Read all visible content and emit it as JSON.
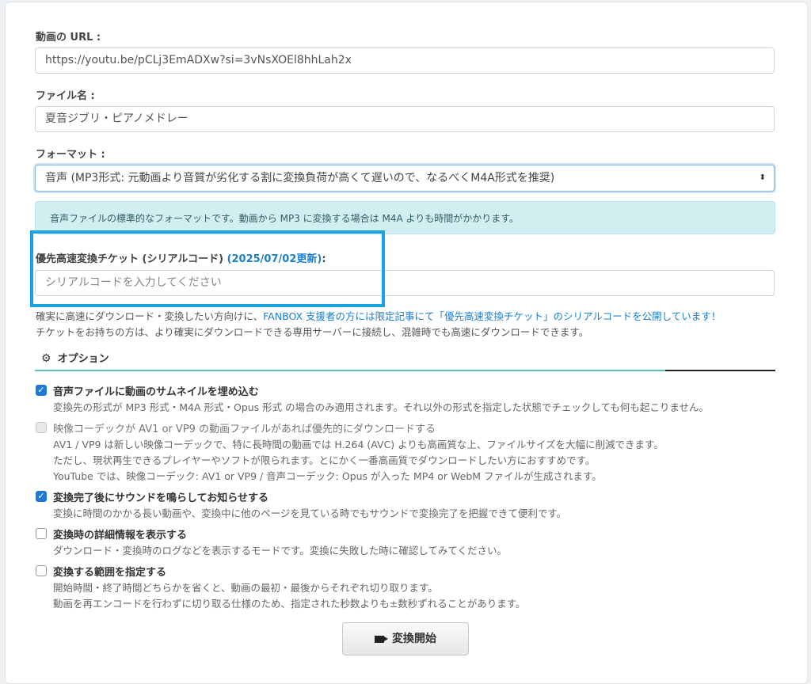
{
  "form": {
    "url_label": "動画の URL :",
    "url_value": "https://youtu.be/pCLj3EmADXw?si=3vNsXOEl8hhLah2x",
    "filename_label": "ファイル名 :",
    "filename_value": "夏音ジブリ・ピアノメドレー",
    "format_label": "フォーマット :",
    "format_selected": "音声 (MP3形式: 元動画より音質が劣化する割に変換負荷が高くて遅いので、なるべくM4A形式を推奨)",
    "format_info": "音声ファイルの標準的なフォーマットです。動画から MP3 に変換する場合は M4A よりも時間がかかります。",
    "ticket_label": "優先高速変換チケット (シリアルコード)",
    "ticket_update": "(2025/07/02更新)",
    "ticket_colon": ":",
    "ticket_placeholder": "シリアルコードを入力してください",
    "help_line1_a": "確実に高速にダウンロード・変換したい方向けに、",
    "help_line1_link": "FANBOX 支援者の方には限定記事にて「優先高速変換チケット」のシリアルコードを公開しています！",
    "help_line2": "チケットをお持ちの方は、より確実にダウンロードできる専用サーバーに接続し、混雑時でも高速にダウンロードできます。"
  },
  "options": {
    "title": "オプション",
    "items": [
      {
        "label": "音声ファイルに動画のサムネイルを埋め込む",
        "checked": true,
        "desc": [
          "変換先の形式が MP3 形式・M4A 形式・Opus 形式 の場合のみ適用されます。それ以外の形式を指定した状態でチェックしても何も起こりません。"
        ]
      },
      {
        "label": "映像コーデックが AV1 or VP9 の動画ファイルがあれば優先的にダウンロードする",
        "checked": false,
        "disabled": true,
        "desc": [
          "AV1 / VP9 は新しい映像コーデックで、特に長時間の動画では H.264 (AVC) よりも高画質な上、ファイルサイズを大幅に削減できます。",
          "ただし、現状再生できるプレイヤーやソフトが限られます。とにかく一番高画質でダウンロードしたい方におすすめです。",
          "YouTube では、映像コーデック: AV1 or VP9 / 音声コーデック: Opus が入った MP4 or WebM ファイルが生成されます。"
        ]
      },
      {
        "label": "変換完了後にサウンドを鳴らしてお知らせする",
        "checked": true,
        "desc": [
          "変換に時間のかかる長い動画や、変換中に他のページを見ている時でもサウンドで変換完了を把握できて便利です。"
        ]
      },
      {
        "label": "変換時の詳細情報を表示する",
        "checked": false,
        "desc": [
          "ダウンロード・変換時のログなどを表示するモードです。変換に失敗した時に確認してみてください。"
        ]
      },
      {
        "label": "変換する範囲を指定する",
        "checked": false,
        "desc": [
          "開始時間・終了時間どちらかを省くと、動画の最初・最後からそれぞれ切り取ります。",
          "動画を再エンコードを行わずに切り取る仕様のため、指定された秒数よりも±数秒ずれることがあります。"
        ]
      }
    ]
  },
  "submit_label": "変換開始",
  "icons": {
    "gear": "gear-icon",
    "video": "video-camera-icon",
    "check": "check-icon",
    "select": "select-arrows-icon"
  },
  "colors": {
    "accent": "#1e7ad4",
    "highlight": "#18a3e3",
    "info_bg": "#d3eef1",
    "teal_line": "#5bc0c8"
  }
}
